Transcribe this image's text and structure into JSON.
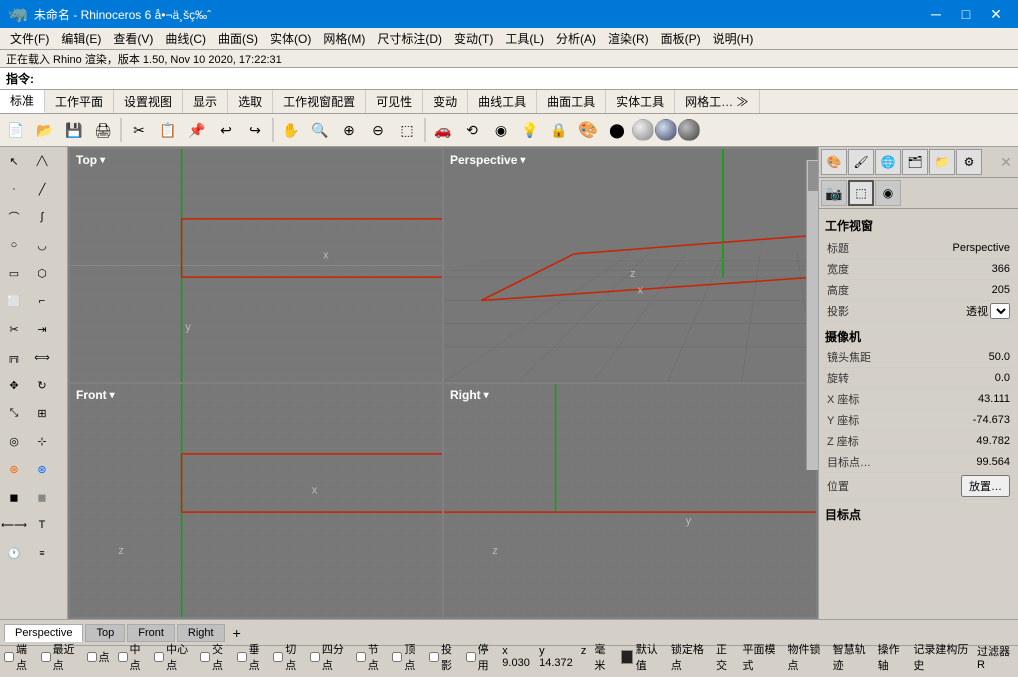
{
  "titlebar": {
    "title": "未命名 - Rhinoceros 6 å•¬ä¸šç‰ˆ",
    "min_btn": "─",
    "max_btn": "□",
    "close_btn": "✕"
  },
  "menubar": {
    "items": [
      "文件(F)",
      "编辑(E)",
      "查看(V)",
      "曲线(C)",
      "曲面(S)",
      "实体(O)",
      "网格(M)",
      "尺寸标注(D)",
      "变动(T)",
      "工具(L)",
      "分析(A)",
      "渲染(R)",
      "面板(P)",
      "说明(H)"
    ]
  },
  "status_top": {
    "text": "正在载入 Rhino 渲染，版本 1.50, Nov 10 2020, 17:22:31"
  },
  "command_line": {
    "label": "指令:",
    "value": ""
  },
  "ribbon": {
    "tabs": [
      "标准",
      "工作平面",
      "设置视图",
      "显示",
      "选取",
      "工作视窗配置",
      "可见性",
      "变动",
      "曲线工具",
      "曲面工具",
      "实体工具",
      "网格工… ≫"
    ],
    "active_tab": "标准"
  },
  "viewports": {
    "top_left": {
      "label": "Top",
      "has_dropdown": true
    },
    "top_right": {
      "label": "Perspective",
      "has_dropdown": true
    },
    "bottom_left": {
      "label": "Front",
      "has_dropdown": true
    },
    "bottom_right": {
      "label": "Right",
      "has_dropdown": true
    }
  },
  "viewport_tabs": {
    "tabs": [
      "Perspective",
      "Top",
      "Front",
      "Right"
    ],
    "active": "Perspective",
    "add_label": "+"
  },
  "right_panel": {
    "title": "工作视窗",
    "properties": [
      {
        "label": "标题",
        "value": "Perspective"
      },
      {
        "label": "宽度",
        "value": "366"
      },
      {
        "label": "高度",
        "value": "205"
      },
      {
        "label": "投影",
        "value": "透视"
      }
    ],
    "camera_title": "摄像机",
    "camera": [
      {
        "label": "镜头焦距",
        "value": "50.0"
      },
      {
        "label": "旋转",
        "value": "0.0"
      },
      {
        "label": "X 座标",
        "value": "43.111"
      },
      {
        "label": "Y 座标",
        "value": "-74.673"
      },
      {
        "label": "Z 座标",
        "value": "49.782"
      },
      {
        "label": "目标点…",
        "value": "99.564"
      }
    ],
    "location_label": "位置",
    "location_btn": "放置…",
    "target_title": "目标点"
  },
  "status_bottom": {
    "snaps": [
      "端点",
      "最近点",
      "点",
      "中点",
      "中心点",
      "交点",
      "垂点",
      "切点",
      "四分点",
      "节点",
      "顶点",
      "投影",
      "停用"
    ],
    "coords": [
      {
        "label": "x",
        "value": "9.030"
      },
      {
        "label": "y",
        "value": "14.372"
      },
      {
        "label": "z",
        "value": ""
      }
    ],
    "unit": "毫米",
    "swatch": "默认值",
    "mode_items": [
      "锁定格点",
      "正交",
      "平面模式",
      "物件锁点",
      "智慧轨迹",
      "操作轴",
      "记录建构历史",
      "过滤器 R"
    ]
  }
}
